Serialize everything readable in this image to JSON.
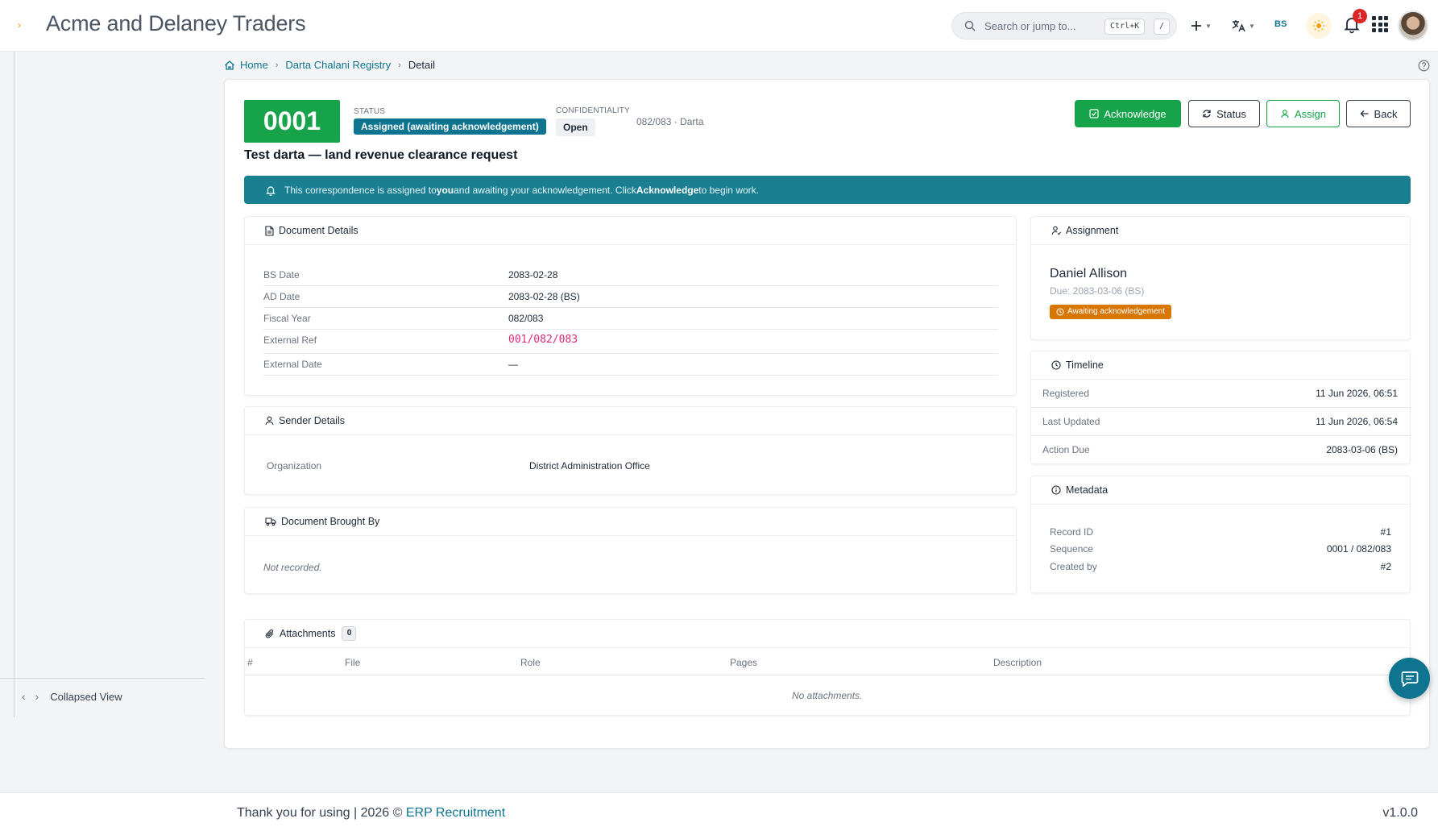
{
  "app": {
    "title": "Acme and Delaney Traders"
  },
  "topbar": {
    "search_placeholder": "Search or jump to...",
    "search_shortcut": "Ctrl+K",
    "search_shortcut_alt": "/",
    "calendar_mode": "BS",
    "notifications_count": "1",
    "icons": [
      "search-icon",
      "plus-icon",
      "translate-icon",
      "sun-icon",
      "bell-icon",
      "apps-grid-icon"
    ]
  },
  "sidebar": {
    "collapse_label": "Collapsed View"
  },
  "breadcrumb": {
    "home": "Home",
    "registry": "Darta Chalani Registry",
    "current": "Detail"
  },
  "record": {
    "number": "0001",
    "status_label": "Status",
    "status_value": "Assigned (awaiting acknowledgement)",
    "confidentiality_label": "Confidentiality",
    "confidentiality_value": "Open",
    "fy_type": "082/083 · Darta",
    "title": "Test darta — land revenue clearance request"
  },
  "actions": {
    "acknowledge": "Acknowledge",
    "status": "Status",
    "assign": "Assign",
    "back": "Back"
  },
  "alert": {
    "pre": "This correspondence is assigned to",
    "you": "you",
    "mid": "and awaiting your acknowledgement. Click",
    "ack": "Acknowledge",
    "post": "to begin work."
  },
  "document_details": {
    "heading": "Document Details",
    "rows": [
      {
        "label": "BS Date",
        "value": "2083-02-28"
      },
      {
        "label": "AD Date",
        "value": "2083-02-28 (BS)"
      },
      {
        "label": "Fiscal Year",
        "value": "082/083"
      },
      {
        "label": "External Ref",
        "value": "001/082/083"
      },
      {
        "label": "External Date",
        "value": "—"
      }
    ]
  },
  "sender_details": {
    "heading": "Sender Details",
    "org_label": "Organization",
    "org_value": "District Administration Office"
  },
  "brought_by": {
    "heading": "Document Brought By",
    "empty": "Not recorded."
  },
  "assignment": {
    "heading": "Assignment",
    "name": "Daniel Allison",
    "due": "Due: 2083-03-06 (BS)",
    "badge": "Awaiting acknowledgement"
  },
  "timeline": {
    "heading": "Timeline",
    "rows": [
      {
        "label": "Registered",
        "value": "11 Jun 2026, 06:51"
      },
      {
        "label": "Last Updated",
        "value": "11 Jun 2026, 06:54"
      },
      {
        "label": "Action Due",
        "value": "2083-03-06 (BS)"
      }
    ]
  },
  "metadata": {
    "heading": "Metadata",
    "rows": [
      {
        "label": "Record ID",
        "value": "#1"
      },
      {
        "label": "Sequence",
        "value": "0001 / 082/083"
      },
      {
        "label": "Created by",
        "value": "#2"
      }
    ]
  },
  "attachments": {
    "heading": "Attachments",
    "count": "0",
    "columns": [
      "#",
      "File",
      "Role",
      "Pages",
      "Description"
    ],
    "empty": "No attachments."
  },
  "footer": {
    "thanks": "Thank you for using | 2026 © ",
    "link": "ERP Recruitment",
    "version": "v1.0.0"
  },
  "colors": {
    "primary_teal": "#0e7490",
    "success_green": "#16a34a",
    "warning_orange": "#d97706",
    "danger_red": "#dc2626"
  }
}
